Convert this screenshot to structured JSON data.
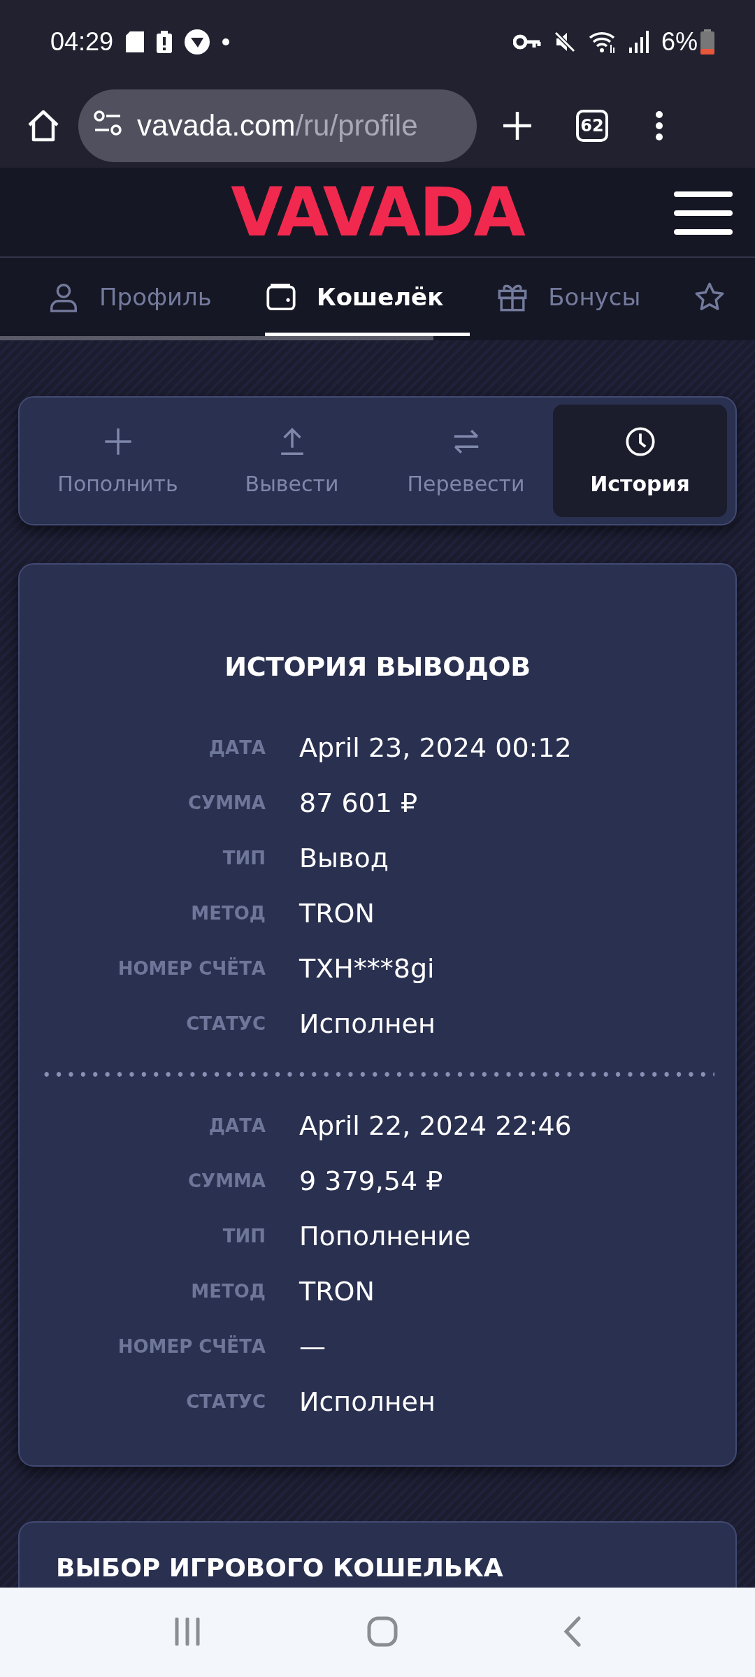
{
  "status_bar": {
    "time": "04:29",
    "battery": "6%"
  },
  "browser": {
    "url_host": "vavada.com",
    "url_path": "/ru/profile",
    "tab_count": "62"
  },
  "site": {
    "logo": "VAVADA"
  },
  "profile_tabs": [
    {
      "kind": "user",
      "label": "Профиль",
      "selected": false
    },
    {
      "kind": "wallet",
      "label": "Кошелёк",
      "selected": true
    },
    {
      "kind": "gift",
      "label": "Бонусы",
      "selected": false
    },
    {
      "kind": "star",
      "selected": false
    }
  ],
  "wallet_actions": [
    {
      "kind": "plus",
      "label": "Пополнить",
      "selected": false
    },
    {
      "kind": "upload",
      "label": "Вывести",
      "selected": false
    },
    {
      "kind": "transfer",
      "label": "Перевести",
      "selected": false
    },
    {
      "kind": "clock",
      "label": "История",
      "selected": true
    }
  ],
  "history": {
    "title": "ИСТОРИЯ ВЫВОДОВ",
    "entries": [
      {
        "fields": [
          {
            "label": "ДАТА",
            "value": "April 23, 2024 00:12"
          },
          {
            "label": "СУММА",
            "value": "87 601 ₽"
          },
          {
            "label": "ТИП",
            "value": "Вывод"
          },
          {
            "label": "МЕТОД",
            "value": "TRON"
          },
          {
            "label": "НОМЕР СЧЁТА",
            "value": "TXH***8gi"
          },
          {
            "label": "СТАТУС",
            "value": "Исполнен"
          }
        ]
      },
      {
        "fields": [
          {
            "label": "ДАТА",
            "value": "April 22, 2024 22:46"
          },
          {
            "label": "СУММА",
            "value": "9 379,54 ₽"
          },
          {
            "label": "ТИП",
            "value": "Пополнение"
          },
          {
            "label": "МЕТОД",
            "value": "TRON"
          },
          {
            "label": "НОМЕР СЧЁТА",
            "value": "—"
          },
          {
            "label": "СТАТУС",
            "value": "Исполнен"
          }
        ]
      }
    ]
  },
  "wallet_select": {
    "title": "ВЫБОР ИГРОВОГО КОШЕЛЬКА"
  }
}
